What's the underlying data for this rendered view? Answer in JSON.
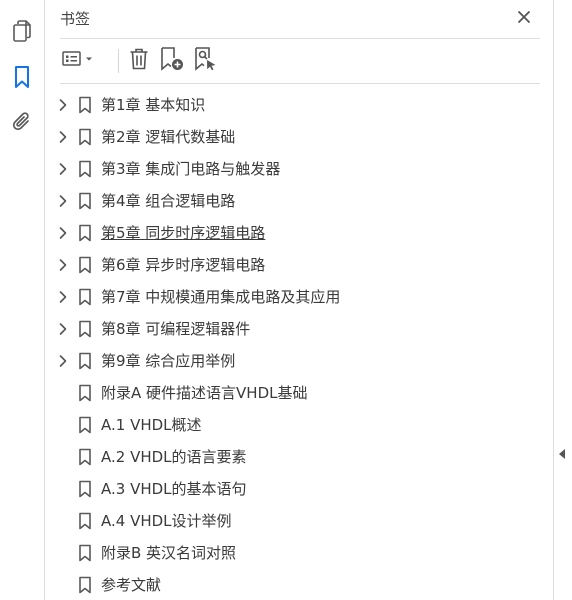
{
  "rail": {
    "items": [
      {
        "name": "pages-icon",
        "active": false
      },
      {
        "name": "bookmarks-icon",
        "active": true
      },
      {
        "name": "attachments-icon",
        "active": false
      }
    ]
  },
  "panel": {
    "title": "书签",
    "close_icon": "close-icon",
    "toolbar": {
      "options_icon": "list-options-icon",
      "delete_icon": "trash-icon",
      "new_bookmark_icon": "new-bookmark-icon",
      "find_bookmark_icon": "find-current-bookmark-icon"
    }
  },
  "colors": {
    "accent": "#1473e6",
    "icon": "#5a5a5a",
    "text": "#3a3a3a",
    "border": "#dedede"
  },
  "bookmarks": [
    {
      "label": "第1章 基本知识",
      "expandable": true,
      "underlined": false
    },
    {
      "label": "第2章 逻辑代数基础",
      "expandable": true,
      "underlined": false
    },
    {
      "label": "第3章 集成门电路与触发器",
      "expandable": true,
      "underlined": false
    },
    {
      "label": "第4章 组合逻辑电路",
      "expandable": true,
      "underlined": false
    },
    {
      "label": "第5章 同步时序逻辑电路",
      "expandable": true,
      "underlined": true
    },
    {
      "label": "第6章 异步时序逻辑电路",
      "expandable": true,
      "underlined": false
    },
    {
      "label": "第7章 中规模通用集成电路及其应用",
      "expandable": true,
      "underlined": false
    },
    {
      "label": "第8章 可编程逻辑器件",
      "expandable": true,
      "underlined": false
    },
    {
      "label": "第9章 综合应用举例",
      "expandable": true,
      "underlined": false
    },
    {
      "label": "附录A 硬件描述语言VHDL基础",
      "expandable": false,
      "underlined": false
    },
    {
      "label": "A.1 VHDL概述",
      "expandable": false,
      "underlined": false
    },
    {
      "label": "A.2 VHDL的语言要素",
      "expandable": false,
      "underlined": false
    },
    {
      "label": "A.3 VHDL的基本语句",
      "expandable": false,
      "underlined": false
    },
    {
      "label": "A.4 VHDL设计举例",
      "expandable": false,
      "underlined": false
    },
    {
      "label": "附录B 英汉名词对照",
      "expandable": false,
      "underlined": false
    },
    {
      "label": "参考文献",
      "expandable": false,
      "underlined": false
    }
  ]
}
